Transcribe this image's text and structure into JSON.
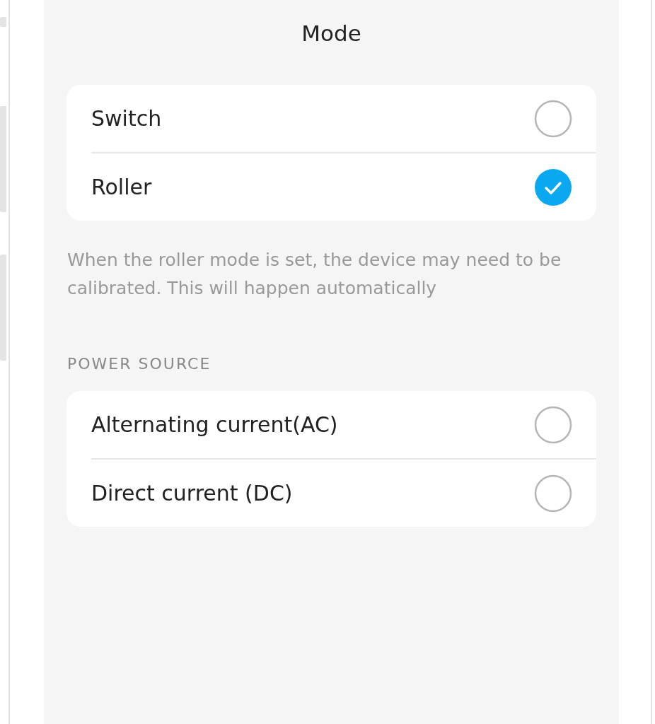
{
  "title": "Mode",
  "mode_options": [
    {
      "label": "Switch",
      "selected": false
    },
    {
      "label": "Roller",
      "selected": true
    }
  ],
  "mode_note": "When the roller mode is set, the device may need to be calibrated. This will happen automatically",
  "power_source": {
    "heading": "POWER SOURCE",
    "options": [
      {
        "label": "Alternating current(AC)",
        "selected": false
      },
      {
        "label": "Direct current (DC)",
        "selected": false
      }
    ]
  }
}
